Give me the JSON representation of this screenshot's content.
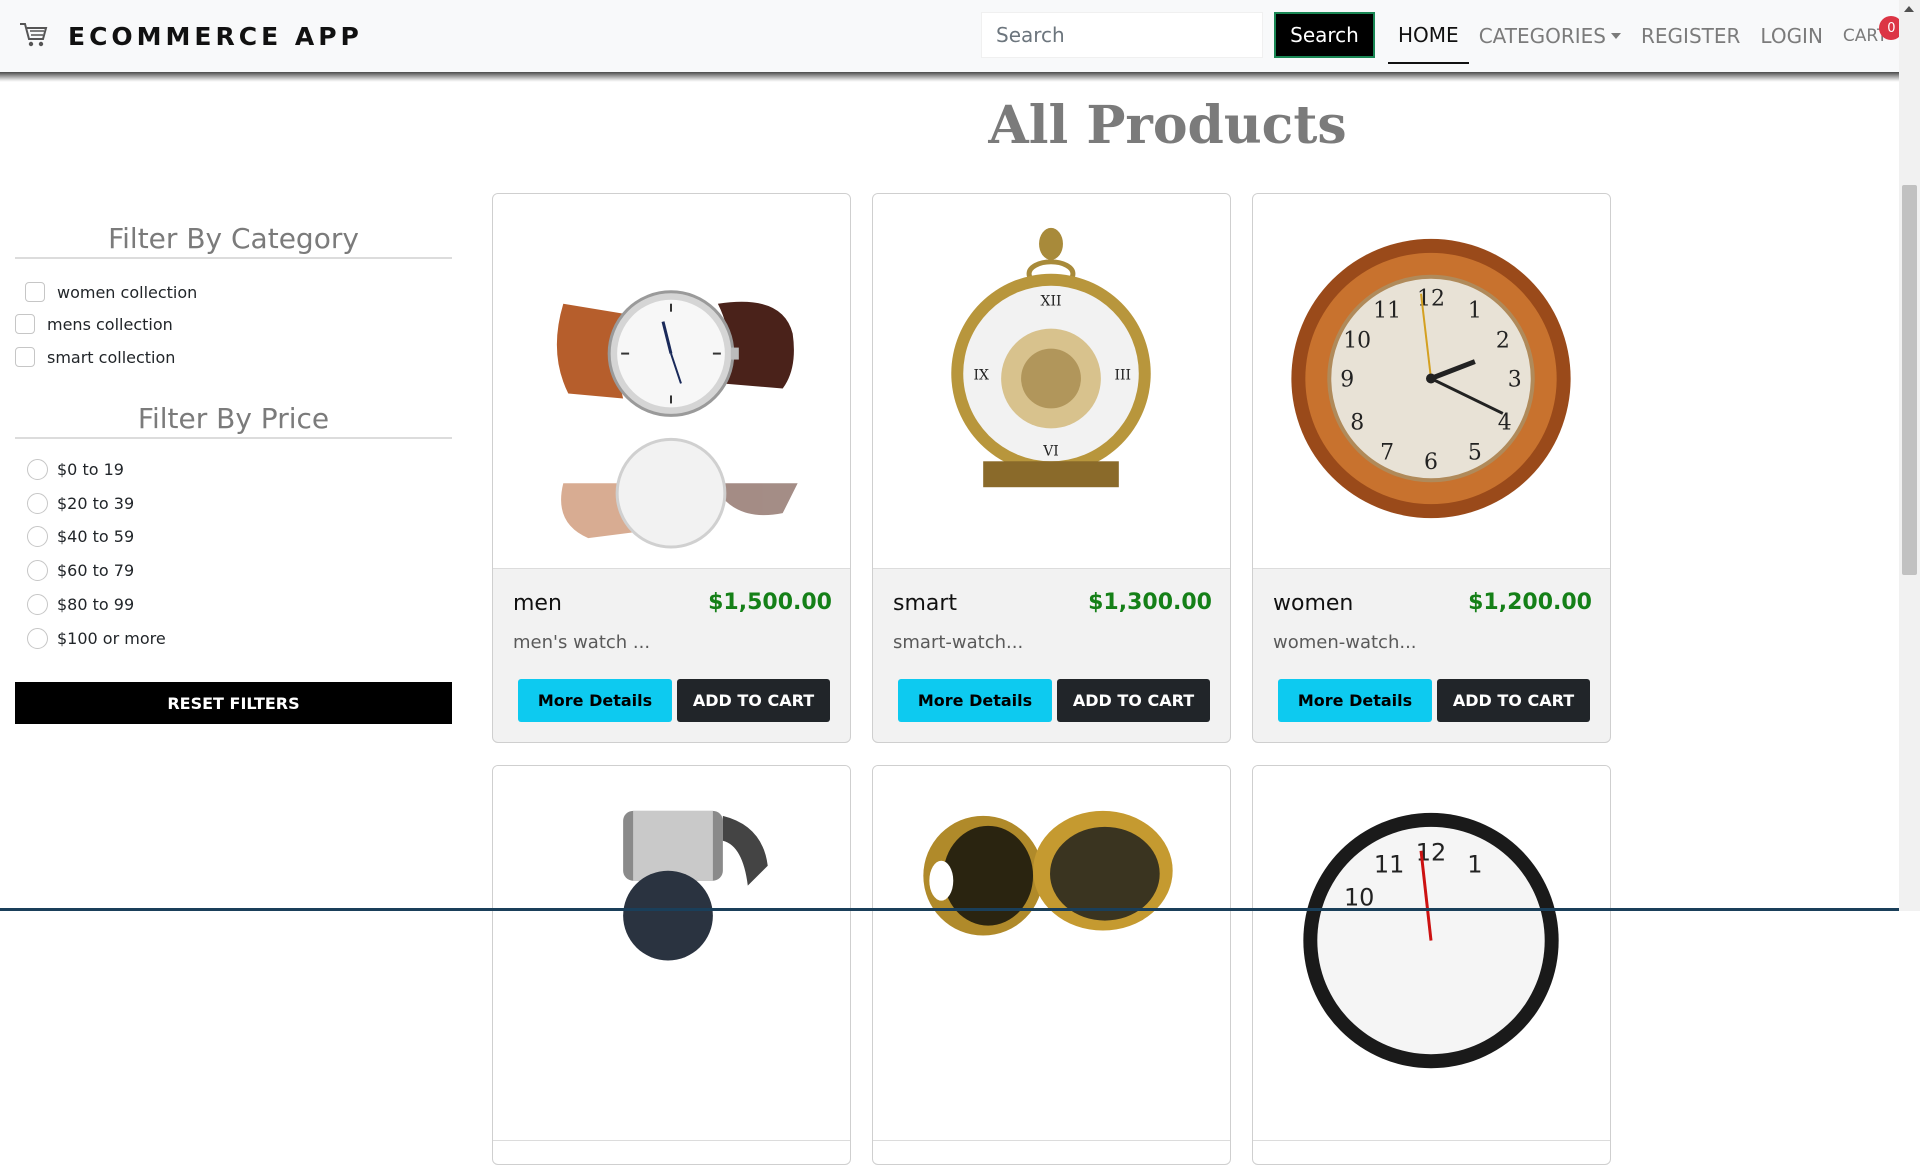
{
  "navbar": {
    "brand": "ECOMMERCE APP",
    "brand_icon": "cart-icon",
    "search": {
      "placeholder": "Search",
      "value": "",
      "button_label": "Search"
    },
    "links": {
      "home": "HOME",
      "categories": "CATEGORIES",
      "register": "REGISTER",
      "login": "LOGIN",
      "cart": "CART"
    },
    "cart_count": "0"
  },
  "page_title": "All Products",
  "filters": {
    "category_heading": "Filter By Category",
    "categories": [
      "women collection",
      "mens collection",
      "smart collection"
    ],
    "price_heading": "Filter By Price",
    "prices": [
      "$0 to 19",
      "$20 to 39",
      "$40 to 59",
      "$60 to 79",
      "$80 to 99",
      "$100 or more"
    ],
    "reset_label": "RESET FILTERS"
  },
  "products": [
    {
      "name": "men",
      "price": "$1,500.00",
      "description": "men's watch ...",
      "image": "wristwatch-image"
    },
    {
      "name": "smart",
      "price": "$1,300.00",
      "description": "smart-watch...",
      "image": "pocket-watch-image"
    },
    {
      "name": "women",
      "price": "$1,200.00",
      "description": "women-watch...",
      "image": "wall-clock-image"
    }
  ],
  "product_buttons": {
    "details": "More Details",
    "add_to_cart": "ADD TO CART"
  },
  "partial_products": [
    {
      "image": "steel-watch-image"
    },
    {
      "image": "gold-pocket-watch-image"
    },
    {
      "image": "black-wall-clock-image"
    }
  ],
  "colors": {
    "price": "#158018",
    "details_button": "#0dcaf0",
    "cart_button": "#212529",
    "badge": "#dc3545"
  }
}
